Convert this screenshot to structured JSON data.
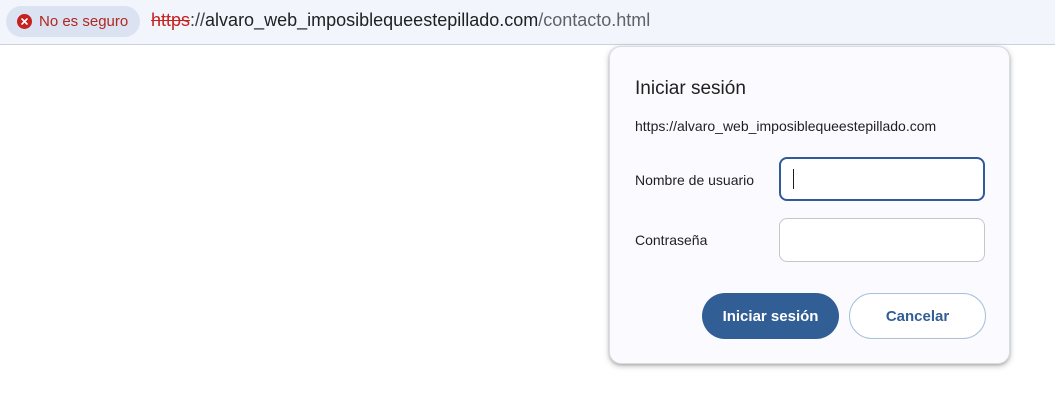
{
  "address_bar": {
    "security_label": "No es seguro",
    "url_scheme": "https",
    "url_separator": "://",
    "url_host": "alvaro_web_imposiblequeestepillado.com",
    "url_path": "/contacto.html",
    "security_icon": "warning-x-icon"
  },
  "dialog": {
    "title": "Iniciar sesión",
    "origin": "https://alvaro_web_imposiblequeestepillado.com",
    "username_label": "Nombre de usuario",
    "username_value": "",
    "password_label": "Contraseña",
    "password_value": "",
    "submit_label": "Iniciar sesión",
    "cancel_label": "Cancelar"
  },
  "colors": {
    "primary": "#325e96",
    "warning": "#c5221f"
  }
}
